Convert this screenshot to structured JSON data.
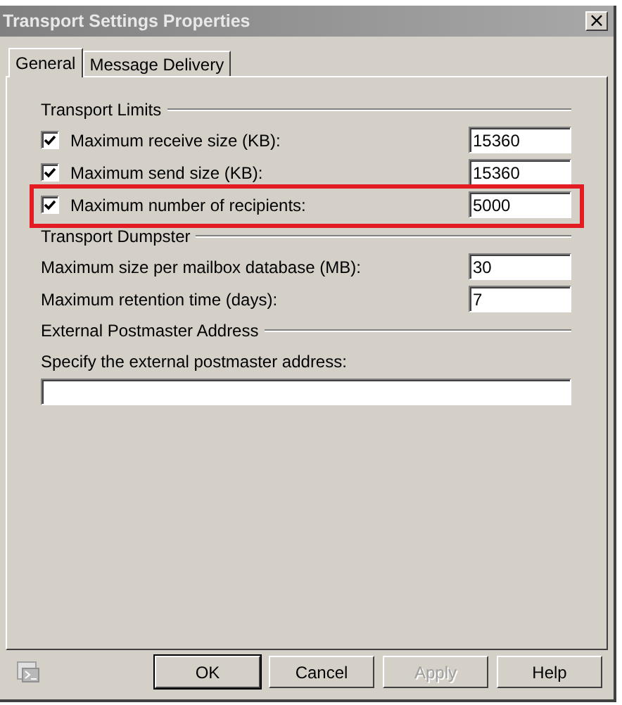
{
  "window": {
    "title": "Transport Settings Properties",
    "close": "×"
  },
  "tabs": [
    {
      "label": "General",
      "selected": true
    },
    {
      "label": "Message Delivery",
      "selected": false
    }
  ],
  "sections": [
    {
      "title": "Transport Limits",
      "rows": [
        {
          "kind": "checkbox",
          "label": "Maximum receive size (KB):",
          "checked": true,
          "value": "15360"
        },
        {
          "kind": "checkbox",
          "label": "Maximum send size (KB):",
          "checked": true,
          "value": "15360"
        },
        {
          "kind": "checkbox",
          "label": "Maximum number of recipients:",
          "checked": true,
          "value": "5000",
          "highlighted": true
        }
      ]
    },
    {
      "title": "Transport Dumpster",
      "rows": [
        {
          "kind": "plain",
          "label": "Maximum size per mailbox database (MB):",
          "value": "30"
        },
        {
          "kind": "plain",
          "label": "Maximum retention time (days):",
          "value": "7"
        }
      ]
    },
    {
      "title": "External Postmaster Address",
      "rows": [
        {
          "kind": "wide",
          "label": "Specify the external postmaster address:",
          "value": ""
        }
      ]
    }
  ],
  "buttons": [
    {
      "label": "OK",
      "default": true,
      "disabled": false
    },
    {
      "label": "Cancel",
      "default": false,
      "disabled": false
    },
    {
      "label": "Apply",
      "default": false,
      "disabled": true
    },
    {
      "label": "Help",
      "default": false,
      "disabled": false
    }
  ]
}
